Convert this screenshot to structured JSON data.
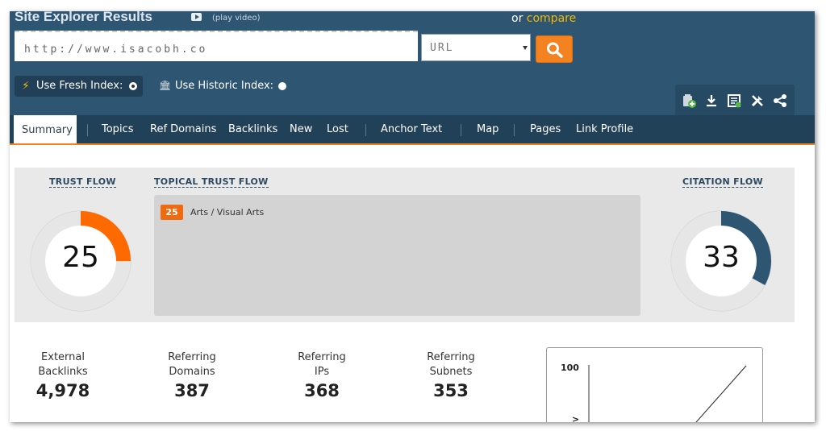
{
  "header": {
    "title": "Site Explorer Results",
    "play_video": "(play video)",
    "or": "or",
    "compare": "compare"
  },
  "search": {
    "url_value": "http://www.isacobh.co",
    "scope_value": "URL",
    "button_icon": "search-icon"
  },
  "index": {
    "fresh_label": "Use Fresh Index:",
    "historic_label": "Use Historic Index:",
    "fresh_selected": true
  },
  "toolbar": {
    "icons": [
      "add-to-bucket-icon",
      "download-icon",
      "report-icon",
      "tools-icon",
      "share-icon"
    ]
  },
  "tabs": [
    {
      "label": "Summary",
      "active": true
    },
    {
      "label": "Topics"
    },
    {
      "label": "Ref Domains"
    },
    {
      "label": "Backlinks"
    },
    {
      "label": "New"
    },
    {
      "label": "Lost"
    },
    {
      "label": "Anchor Text"
    },
    {
      "label": "Map"
    },
    {
      "label": "Pages"
    },
    {
      "label": "Link Profile"
    }
  ],
  "trust_flow": {
    "label": "TRUST FLOW",
    "value": 25
  },
  "topical_trust_flow": {
    "label": "TOPICAL TRUST FLOW",
    "topics": [
      {
        "score": "25",
        "name": "Arts / Visual Arts"
      }
    ]
  },
  "citation_flow": {
    "label": "CITATION FLOW",
    "value": 33
  },
  "metrics": [
    {
      "label_line1": "External",
      "label_line2": "Backlinks",
      "value": "4,978"
    },
    {
      "label_line1": "Referring",
      "label_line2": "Domains",
      "value": "387"
    },
    {
      "label_line1": "Referring",
      "label_line2": "IPs",
      "value": "368"
    },
    {
      "label_line1": "Referring",
      "label_line2": "Subnets",
      "value": "353"
    }
  ],
  "mini_chart": {
    "y_top_label": "100",
    "y_marker": ">"
  },
  "colors": {
    "header": "#2e5571",
    "accent": "#f58220",
    "citation": "#2e5571",
    "trust": "#ff6a00"
  }
}
